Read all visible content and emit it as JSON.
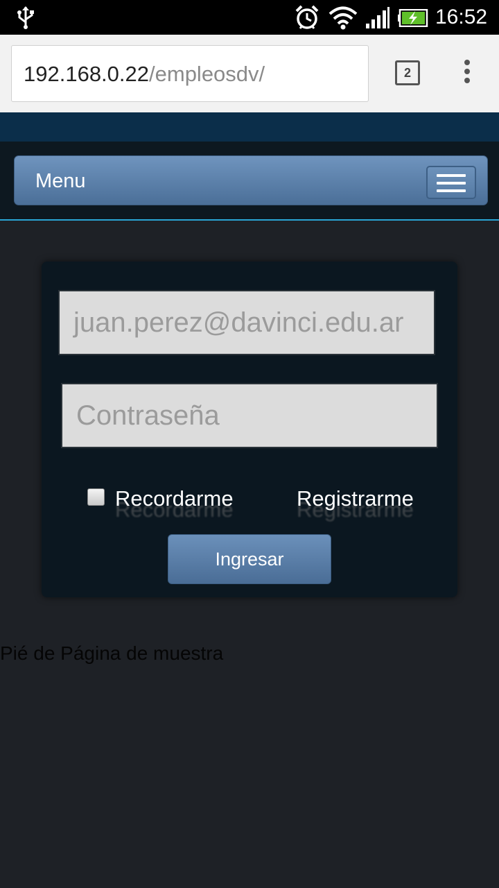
{
  "status_bar": {
    "time": "16:52",
    "icons": [
      "usb-icon",
      "alarm-icon",
      "wifi-icon",
      "signal-icon",
      "battery-charging-icon"
    ]
  },
  "browser": {
    "url_host": "192.168.0.22",
    "url_path": "/empleosdv/",
    "tab_count": "2",
    "icons": [
      "tabs-icon",
      "overflow-menu-icon"
    ]
  },
  "nav": {
    "menu_label": "Menu",
    "toggle_icon": "hamburger-icon"
  },
  "login": {
    "email_placeholder": "juan.perez@davinci.edu.ar",
    "password_placeholder": "Contraseña",
    "remember_label": "Recordarme",
    "register_link": "Registrarme",
    "submit_label": "Ingresar"
  },
  "footer": {
    "text": "Pié de Página de muestra"
  },
  "colors": {
    "page_background": "#1e2126",
    "header_band": "#0b2e4a",
    "panel_background": "#0b1720",
    "button_blue": "#5a7fa8",
    "accent_line": "#2aa6d6"
  }
}
